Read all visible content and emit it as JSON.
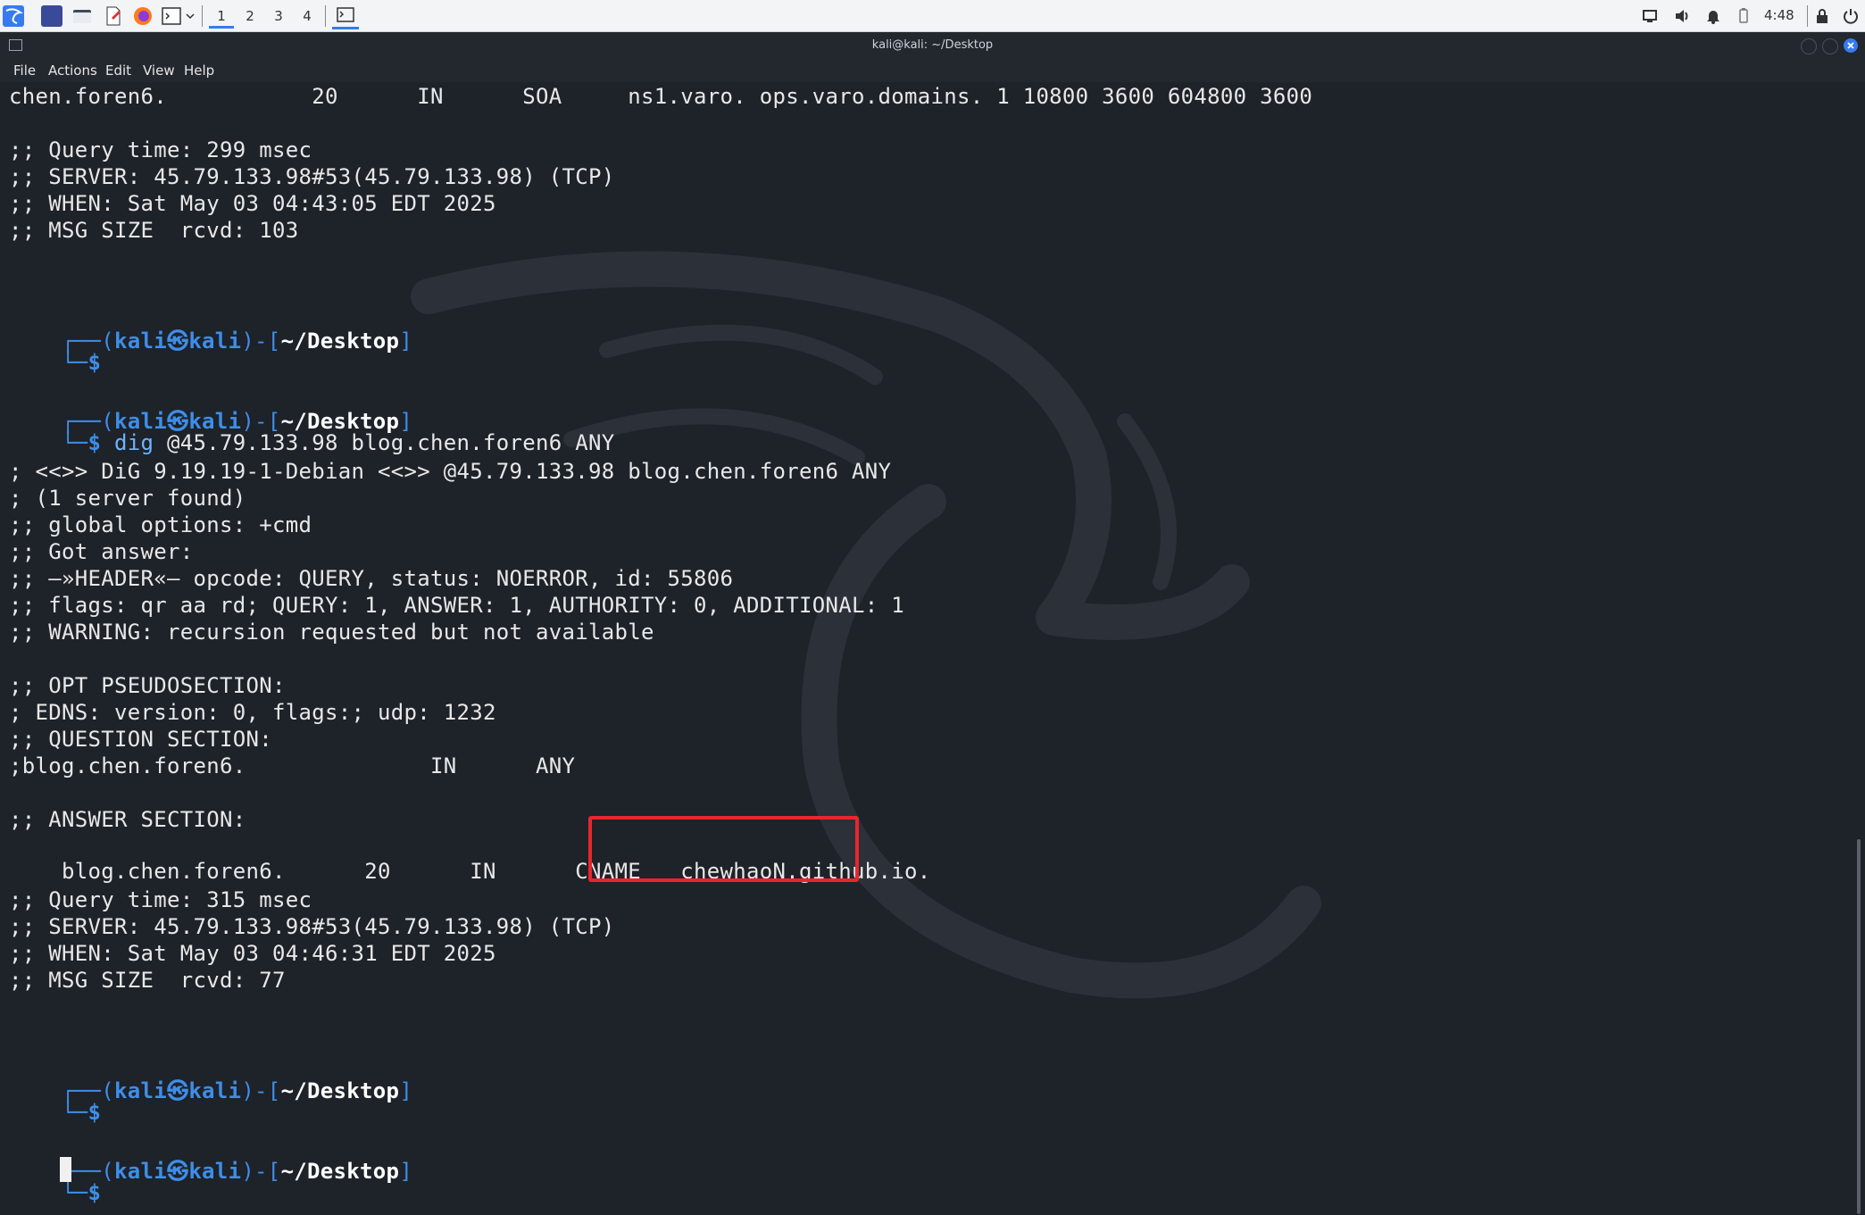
{
  "taskbar": {
    "workspaces": [
      "1",
      "2",
      "3",
      "4"
    ],
    "clock": "4:48",
    "icons": [
      "kali-menu-icon",
      "desktop-icon",
      "file-manager-icon",
      "text-editor-icon",
      "firefox-icon",
      "terminal-icon",
      "chevron-down-icon"
    ],
    "tray_icons": [
      "display-icon",
      "volume-icon",
      "notification-bell-icon",
      "battery-icon",
      "lock-icon",
      "power-icon"
    ]
  },
  "window": {
    "title": "kali@kali: ~/Desktop"
  },
  "menubar": {
    "items": [
      "File",
      "Actions",
      "Edit",
      "View",
      "Help"
    ]
  },
  "prompt": {
    "user": "kali",
    "at": "㉿",
    "host": "kali",
    "path": "~/Desktop",
    "dollar": "$"
  },
  "terminal": {
    "lines": [
      "chen.foren6.           20      IN      SOA     ns1.varo. ops.varo.domains. 1 10800 3600 604800 3600",
      "",
      ";; Query time: 299 msec",
      ";; SERVER: 45.79.133.98#53(45.79.133.98) (TCP)",
      ";; WHEN: Sat May 03 04:43:05 EDT 2025",
      ";; MSG SIZE  rcvd: 103",
      "; <<>> DiG 9.19.19-1-Debian <<>> @45.79.133.98 blog.chen.foren6 ANY",
      "; (1 server found)",
      ";; global options: +cmd",
      ";; Got answer:",
      ";; —»HEADER«— opcode: QUERY, status: NOERROR, id: 55806",
      ";; flags: qr aa rd; QUERY: 1, ANSWER: 1, AUTHORITY: 0, ADDITIONAL: 1",
      ";; WARNING: recursion requested but not available",
      ";; OPT PSEUDOSECTION:",
      "; EDNS: version: 0, flags:; udp: 1232",
      ";; QUESTION SECTION:",
      ";blog.chen.foren6.              IN      ANY",
      ";; ANSWER SECTION:",
      "blog.chen.foren6.      20      IN      CNAME   ",
      ";; Query time: 315 msec",
      ";; SERVER: 45.79.133.98#53(45.79.133.98) (TCP)",
      ";; WHEN: Sat May 03 04:46:31 EDT 2025",
      ";; MSG SIZE  rcvd: 77"
    ],
    "command_name": "dig",
    "command_args": " @45.79.133.98 blog.chen.foren6 ANY",
    "cname_value": "chewhaoN.github.io."
  },
  "colors": {
    "highlight": "#e8262d",
    "prompt_blue": "#3e8ee8",
    "background": "#1e2229"
  }
}
